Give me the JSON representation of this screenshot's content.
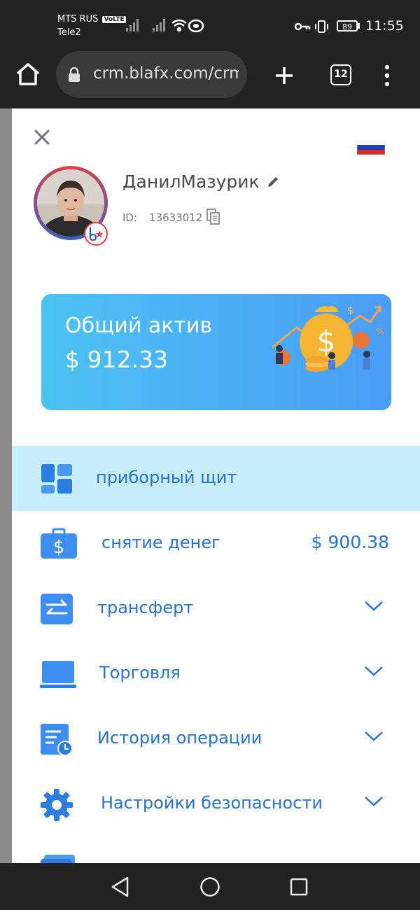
{
  "status_bar": {
    "carrier_primary": "MTS RUS",
    "volte": "VoLTE",
    "carrier_secondary": "Tele2",
    "battery": "89",
    "time": "11:55"
  },
  "browser": {
    "url": "crm.blafx.com/crm",
    "tab_count": "12"
  },
  "profile": {
    "username": "ДанилМазурик",
    "id_label": "ID:",
    "id_value": "13633012"
  },
  "asset_card": {
    "title": "Общий актив",
    "value": "$ 912.33"
  },
  "menu": [
    {
      "label": "приборный щит",
      "icon": "dashboard-icon",
      "active": true
    },
    {
      "label": "снятие денег",
      "icon": "withdraw-icon",
      "amount": "$ 900.38"
    },
    {
      "label": "трансферт",
      "icon": "transfer-icon",
      "expandable": true
    },
    {
      "label": "Торговля",
      "icon": "trading-icon",
      "expandable": true
    },
    {
      "label": "История операции",
      "icon": "history-icon",
      "expandable": true
    },
    {
      "label": "Настройки безопасности",
      "icon": "gear-icon",
      "expandable": true
    }
  ],
  "colors": {
    "accent": "#2a72c9",
    "active_bg": "#c9eefb",
    "card_gradient_start": "#4cc2f3",
    "card_gradient_end": "#4a9df5"
  }
}
